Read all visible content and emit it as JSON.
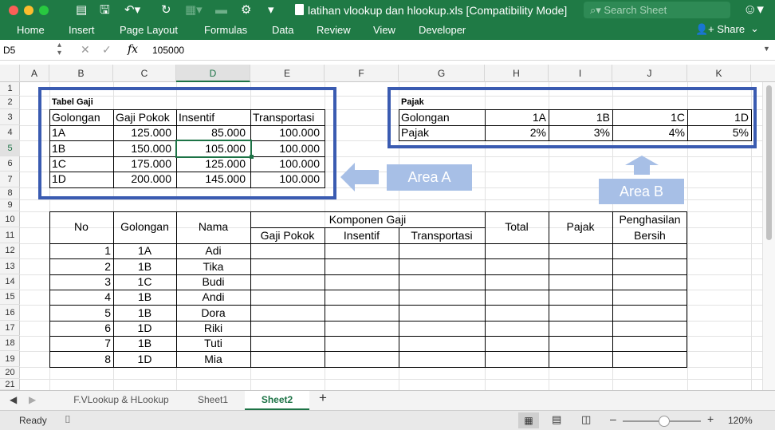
{
  "window": {
    "title": "latihan vlookup dan hlookup.xls  [Compatibility Mode]",
    "search_placeholder": "Search Sheet"
  },
  "ribbon_tabs": [
    "Home",
    "Insert",
    "Page Layout",
    "Formulas",
    "Data",
    "Review",
    "View",
    "Developer"
  ],
  "share_label": "Share",
  "formula_bar": {
    "name_box": "D5",
    "fx": "fx",
    "value": "105000"
  },
  "columns": [
    "A",
    "B",
    "C",
    "D",
    "E",
    "F",
    "G",
    "H",
    "I",
    "J",
    "K"
  ],
  "selected_column": "D",
  "rows": [
    "1",
    "2",
    "3",
    "4",
    "5",
    "6",
    "7",
    "8",
    "9",
    "10",
    "11",
    "12",
    "13",
    "14",
    "15",
    "16",
    "17",
    "18",
    "19",
    "20",
    "21"
  ],
  "selected_row": "5",
  "tabel_gaji": {
    "title": "Tabel Gaji",
    "headers": [
      "Golongan",
      "Gaji Pokok",
      "Insentif",
      "Transportasi"
    ],
    "rows": [
      [
        "1A",
        "125.000",
        "85.000",
        "100.000"
      ],
      [
        "1B",
        "150.000",
        "105.000",
        "100.000"
      ],
      [
        "1C",
        "175.000",
        "125.000",
        "100.000"
      ],
      [
        "1D",
        "200.000",
        "145.000",
        "100.000"
      ]
    ]
  },
  "pajak": {
    "title": "Pajak",
    "row1": [
      "Golongan",
      "1A",
      "1B",
      "1C",
      "1D"
    ],
    "row2": [
      "Pajak",
      "2%",
      "3%",
      "4%",
      "5%"
    ]
  },
  "annotations": {
    "area_a": "Area A",
    "area_b": "Area B"
  },
  "main_table": {
    "headers": {
      "no": "No",
      "golongan": "Golongan",
      "nama": "Nama",
      "komponen": "Komponen Gaji",
      "gaji_pokok": "Gaji Pokok",
      "insentif": "Insentif",
      "transportasi": "Transportasi",
      "total": "Total",
      "pajak": "Pajak",
      "penghasilan1": "Penghasilan",
      "penghasilan2": "Bersih"
    },
    "rows": [
      [
        "1",
        "1A",
        "Adi"
      ],
      [
        "2",
        "1B",
        "Tika"
      ],
      [
        "3",
        "1C",
        "Budi"
      ],
      [
        "4",
        "1B",
        "Andi"
      ],
      [
        "5",
        "1B",
        "Dora"
      ],
      [
        "6",
        "1D",
        "Riki"
      ],
      [
        "7",
        "1B",
        "Tuti"
      ],
      [
        "8",
        "1D",
        "Mia"
      ]
    ]
  },
  "sheet_tabs": [
    "F.VLookup & HLookup",
    "Sheet1",
    "Sheet2"
  ],
  "active_sheet": "Sheet2",
  "status": {
    "ready": "Ready",
    "zoom": "120%"
  },
  "colors": {
    "excel_green": "#1f7a45",
    "area_border": "#3a5bb1",
    "area_label": "#a7bfe6"
  }
}
